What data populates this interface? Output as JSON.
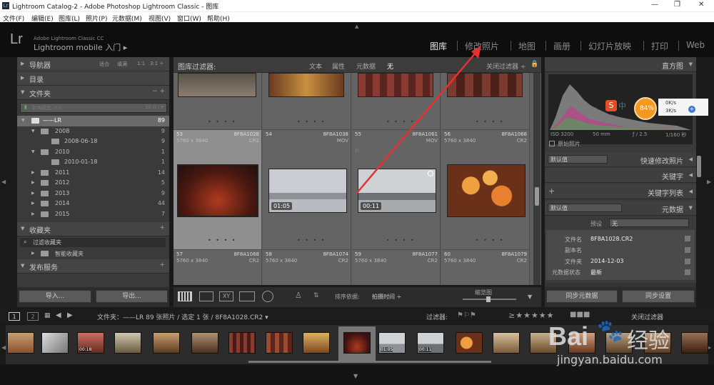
{
  "window": {
    "title": "Lightroom Catalog-2 - Adobe Photoshop Lightroom Classic - 图库"
  },
  "menu": [
    "文件(F)",
    "编辑(E)",
    "图库(L)",
    "照片(P)",
    "元数据(M)",
    "视图(V)",
    "窗口(W)",
    "帮助(H)"
  ],
  "identity": {
    "logo": "Lr",
    "product": "Adobe Lightroom Classic CC",
    "mobile": "Lightroom mobile 入门  ▸"
  },
  "modules": [
    "图库",
    "修改照片",
    "地图",
    "画册",
    "幻灯片放映",
    "打印",
    "Web"
  ],
  "navigator": {
    "label": "导航器",
    "opts": [
      "适合",
      "填满",
      "1:1",
      "3:1 ÷"
    ]
  },
  "catalog_label": "目录",
  "folders": {
    "label": "文件夹",
    "actions": "− +",
    "volume": {
      "name": "本地磁盘 (F:)",
      "space": "30.0 / ▾"
    },
    "rows": [
      {
        "name": "——LR",
        "count": "89"
      },
      {
        "name": "2008",
        "count": "9"
      },
      {
        "name": "2008-06-18",
        "count": "9"
      },
      {
        "name": "2010",
        "count": "1"
      },
      {
        "name": "2010-01-18",
        "count": "1"
      },
      {
        "name": "2011",
        "count": "14"
      },
      {
        "name": "2012",
        "count": "5"
      },
      {
        "name": "2013",
        "count": "9"
      },
      {
        "name": "2014",
        "count": "44"
      },
      {
        "name": "2015",
        "count": "7"
      }
    ]
  },
  "collections": {
    "label": "收藏夹",
    "plus": "+",
    "items": [
      "过滤收藏夹",
      "智能收藏夹"
    ]
  },
  "publish": {
    "label": "发布服务",
    "plus": "+"
  },
  "leftbuttons": {
    "import": "导入...",
    "export": "导出..."
  },
  "filterbar": {
    "label": "图库过滤器:",
    "text": "文本",
    "attr": "属性",
    "meta": "元数据",
    "none": "无",
    "off": "关闭过滤器 ÷"
  },
  "cells_row1": [
    {
      "num": "53",
      "id": "8F8A1028",
      "dim": "5760 x 3840",
      "ext": "CR2"
    },
    {
      "num": "54",
      "id": "8F8A1038",
      "dim": "",
      "ext": "MOV",
      "dur": "01:05"
    },
    {
      "num": "55",
      "id": "8F8A1061",
      "dim": "",
      "ext": "MOV",
      "dur": "00:11"
    },
    {
      "num": "56",
      "id": "8F8A1066",
      "dim": "5760 x 3840",
      "ext": "CR2"
    }
  ],
  "cells_row2": [
    {
      "num": "57",
      "id": "8F8A1068",
      "dim": "5760 x 3840",
      "ext": "CR2"
    },
    {
      "num": "58",
      "id": "8F8A1074",
      "dim": "5760 x 3840",
      "ext": "CR2"
    },
    {
      "num": "59",
      "id": "8F8A1077",
      "dim": "5760 x 3840",
      "ext": "CR2"
    },
    {
      "num": "60",
      "id": "8F8A1079",
      "dim": "5760 x 3840",
      "ext": "CR2"
    }
  ],
  "histogram": {
    "label": "直方图",
    "iso": "ISO 3200",
    "focal": "50 mm",
    "aperture": "ƒ / 2.5",
    "shutter": "1/160 秒",
    "original": "原始照片"
  },
  "overlay": {
    "percent": "84%",
    "up": "0K/s",
    "down": "3K/s"
  },
  "quick": {
    "preset": "默认值",
    "label": "快速修改照片"
  },
  "keywords": {
    "label": "关键字",
    "list": "关键字列表",
    "plus": "+"
  },
  "metadata": {
    "preset": "默认值",
    "label": "元数据",
    "preset_label": "预设",
    "preset_value": "无",
    "fields": [
      {
        "k": "文件名",
        "v": "8F8A1028.CR2"
      },
      {
        "k": "副本名",
        "v": ""
      },
      {
        "k": "文件夹",
        "v": "2014-12-03"
      },
      {
        "k": "元数据状态",
        "v": "最新"
      }
    ]
  },
  "rightbuttons": {
    "sync_meta": "同步元数据",
    "sync_set": "同步设置"
  },
  "toolbar": {
    "sort_label": "排序依据:",
    "sort_value": "拍摄时间 ÷",
    "thumb": "缩览图"
  },
  "statusbar": {
    "p1": "1",
    "p2": "2",
    "path": "文件夹：——LR  89 张照片 / 选定 1 张 / 8F8A1028.CR2 ▾",
    "filter": "过滤器:",
    "off": "关闭过滤器"
  },
  "filmstrip_durations": [
    "00:18",
    "01:05",
    "00:11"
  ],
  "watermark": {
    "brand": "Bai",
    "paw": "🐾",
    "rest": "经验",
    "url": "jingyan.baidu.com"
  },
  "colors": {
    "accent": "#e8e8e8",
    "arrow": "#e83030",
    "selected": "#8f8f8f"
  }
}
